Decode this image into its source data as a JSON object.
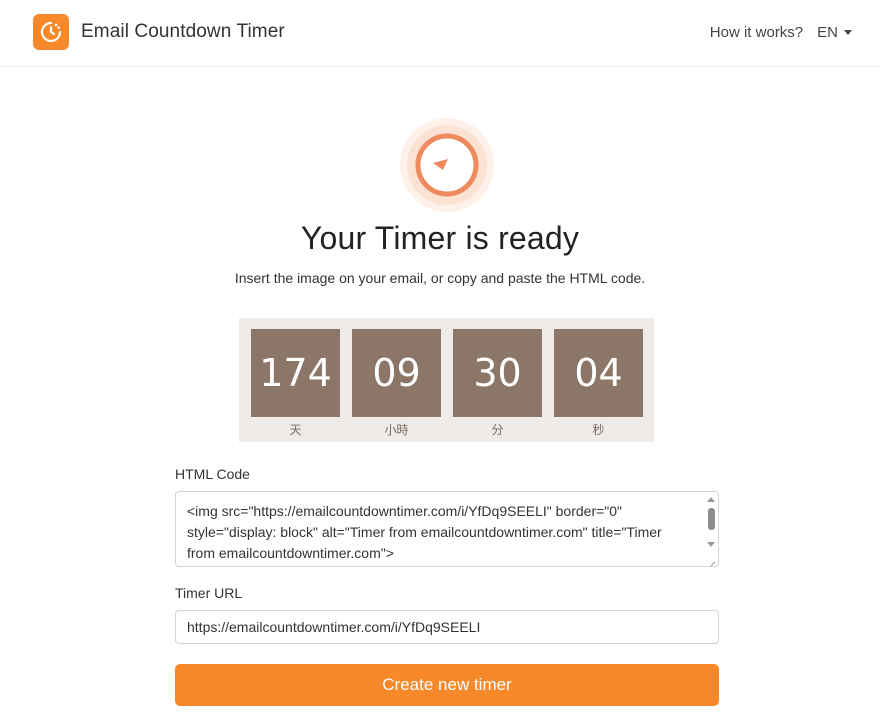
{
  "header": {
    "brand_name": "Email Countdown Timer",
    "how_it_works": "How it works?",
    "language": "EN"
  },
  "hero": {
    "title": "Your Timer is ready",
    "subtitle": "Insert the image on your email, or copy and paste the HTML code."
  },
  "timer": {
    "days": {
      "value": "174",
      "unit": "天"
    },
    "hours": {
      "value": "09",
      "unit": "小時"
    },
    "minutes": {
      "value": "30",
      "unit": "分"
    },
    "seconds": {
      "value": "04",
      "unit": "秒"
    }
  },
  "html_code": {
    "label": "HTML Code",
    "value": "<img src=\"https://emailcountdowntimer.com/i/YfDq9SEELI\" border=\"0\" style=\"display: block\" alt=\"Timer from emailcountdowntimer.com\" title=\"Timer from emailcountdowntimer.com\">"
  },
  "timer_url": {
    "label": "Timer URL",
    "value": "https://emailcountdowntimer.com/i/YfDq9SEELI"
  },
  "actions": {
    "create_new": "Create new timer"
  },
  "colors": {
    "accent": "#f7892a",
    "timer_box": "#8b7668",
    "timer_bg": "#efebe8"
  },
  "icons": {
    "logo": "clock-icon",
    "hero": "timer-icon",
    "language_dropdown": "caret-down-icon"
  }
}
